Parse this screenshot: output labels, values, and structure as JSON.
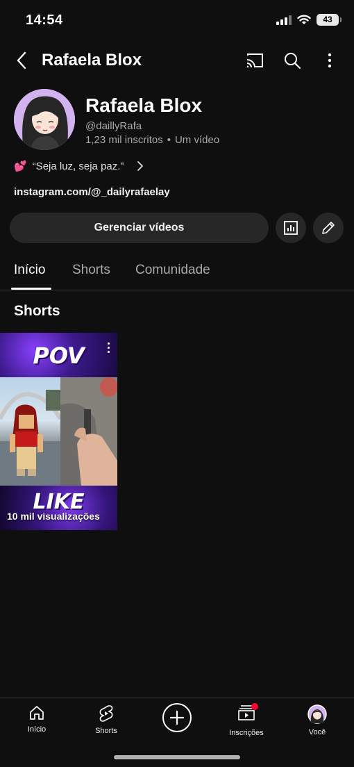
{
  "status_bar": {
    "time": "14:54",
    "battery": "43"
  },
  "header": {
    "title": "Rafaela Blox"
  },
  "channel": {
    "name": "Rafaela Blox",
    "handle": "@daillyRafa",
    "subscribers": "1,23 mil inscritos",
    "separator": "•",
    "video_count": "Um vídeo",
    "description_emoji": "💕",
    "description": "“Seja luz, seja paz.”",
    "link": "instagram.com/@_dailyrafaelay"
  },
  "actions": {
    "manage_label": "Gerenciar vídeos"
  },
  "tabs": [
    {
      "label": "Início"
    },
    {
      "label": "Shorts"
    },
    {
      "label": "Comunidade"
    }
  ],
  "shorts_section": {
    "title": "Shorts",
    "items": [
      {
        "top_text": "POV",
        "bottom_text": "LIKE",
        "views": "10 mil visualizações"
      }
    ]
  },
  "bottom_nav": [
    {
      "label": "Início",
      "icon": "home-icon"
    },
    {
      "label": "Shorts",
      "icon": "shorts-icon"
    },
    {
      "label": "",
      "icon": "create-icon"
    },
    {
      "label": "Inscrições",
      "icon": "subscriptions-icon"
    },
    {
      "label": "Você",
      "icon": "avatar-icon"
    }
  ],
  "colors": {
    "background": "#0f0f0f",
    "button": "#272727",
    "notification": "#ff0033"
  }
}
